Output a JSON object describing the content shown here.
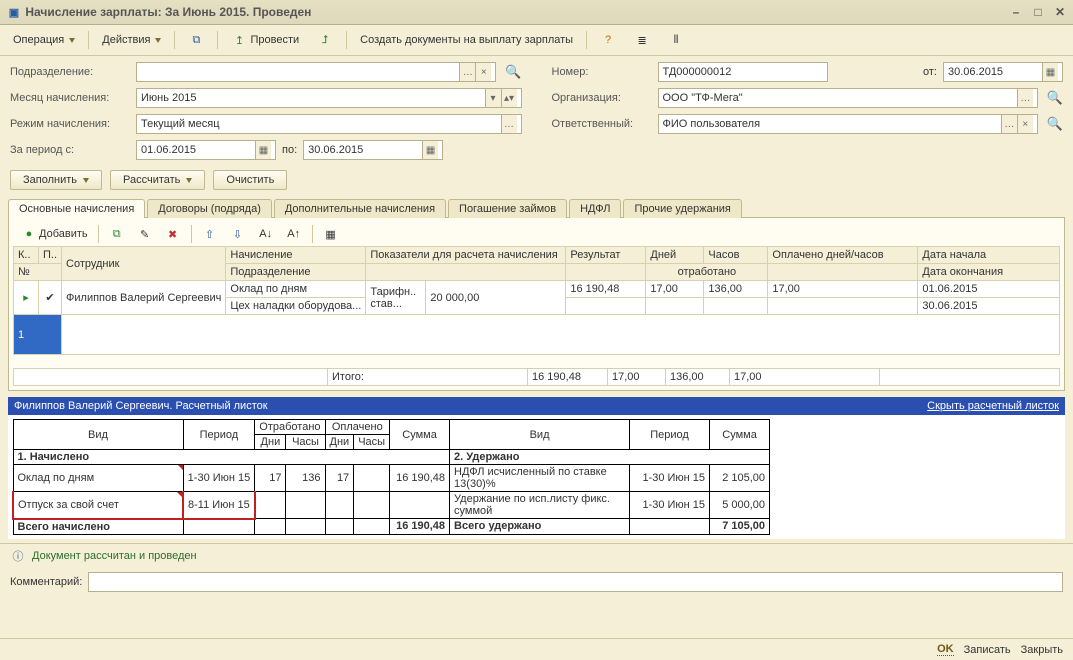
{
  "window": {
    "title": "Начисление зарплаты:  За Июнь 2015. Проведен"
  },
  "toolbar": {
    "operation": "Операция",
    "actions": "Действия",
    "provesti": "Провести",
    "create_docs": "Создать документы на выплату зарплаты"
  },
  "form": {
    "subdivision_label": "Подразделение:",
    "subdivision_value": "",
    "month_label": "Месяц начисления:",
    "month_value": "Июнь 2015",
    "mode_label": "Режим начисления:",
    "mode_value": "Текущий месяц",
    "period_label": "За период с:",
    "period_from": "01.06.2015",
    "period_to_label": "по:",
    "period_to": "30.06.2015",
    "number_label": "Номер:",
    "number_value": "ТД000000012",
    "date_label": "от:",
    "date_value": "30.06.2015",
    "org_label": "Организация:",
    "org_value": "ООО \"ТФ-Мега\"",
    "resp_label": "Ответственный:",
    "resp_value": "ФИО пользователя"
  },
  "actions": {
    "fill": "Заполнить",
    "calc": "Рассчитать",
    "clear": "Очистить"
  },
  "tabs": {
    "main": "Основные начисления",
    "contracts": "Договоры (подряда)",
    "additional": "Дополнительные начисления",
    "loans": "Погашение займов",
    "ndfl": "НДФЛ",
    "other": "Прочие удержания"
  },
  "gridtoolbar": {
    "add": "Добавить"
  },
  "grid": {
    "headers_top": {
      "k": "К..",
      "p": "П..",
      "employee": "Сотрудник",
      "accrual": "Начисление",
      "indicators": "Показатели для расчета начисления",
      "result": "Результат",
      "days": "Дней",
      "hours": "Часов",
      "paid": "Оплачено дней/часов",
      "datestart": "Дата начала"
    },
    "headers_bottom": {
      "no": "№",
      "subdivision": "Подразделение",
      "worked": "отработано",
      "dateend": "Дата окончания"
    },
    "rows": {
      "number": "1",
      "employee": "Филиппов Валерий Сергеевич",
      "accrual1": "Оклад по дням",
      "accrual2": "Цех наладки оборудова...",
      "indicator_label": "Тарифн..\nстав...",
      "indicator_value": "20 000,00",
      "result": "16 190,48",
      "days": "17,00",
      "hours": "136,00",
      "paid": "17,00",
      "date1": "01.06.2015",
      "date2": "30.06.2015"
    },
    "total_label": "Итого:",
    "total_result": "16 190,48",
    "total_days": "17,00",
    "total_hours": "136,00",
    "total_paid": "17,00"
  },
  "payslip": {
    "header": "Филиппов Валерий Сергеевич. Расчетный листок",
    "hide": "Скрыть расчетный листок",
    "cols": {
      "kind": "Вид",
      "period": "Период",
      "worked": "Отработано",
      "paid": "Оплачено",
      "days": "Дни",
      "hours": "Часы",
      "sum": "Сумма"
    },
    "sec1": "1. Начислено",
    "sec2": "2. Удержано",
    "r1": {
      "kind": "Оклад по дням",
      "period": "1-30 Июн 15",
      "days": "17",
      "hours": "136",
      "pdays": "17",
      "sum": "16 190,48"
    },
    "r2": {
      "kind": "Отпуск за свой счет",
      "period": "8-11 Июн 15"
    },
    "r3": {
      "kind": "Всего начислено",
      "sum": "16 190,48"
    },
    "d1": {
      "kind": "НДФЛ исчисленный по ставке 13(30)%",
      "period": "1-30 Июн 15",
      "sum": "2 105,00"
    },
    "d2": {
      "kind": "Удержание по исп.листу фикс. суммой",
      "period": "1-30 Июн 15",
      "sum": "5 000,00"
    },
    "d3": {
      "kind": "Всего удержано",
      "sum": "7 105,00"
    }
  },
  "status": {
    "msg": "Документ рассчитан и проведен"
  },
  "comment_label": "Комментарий:",
  "comment_value": "",
  "bottom": {
    "ok": "OK",
    "save": "Записать",
    "close": "Закрыть"
  }
}
